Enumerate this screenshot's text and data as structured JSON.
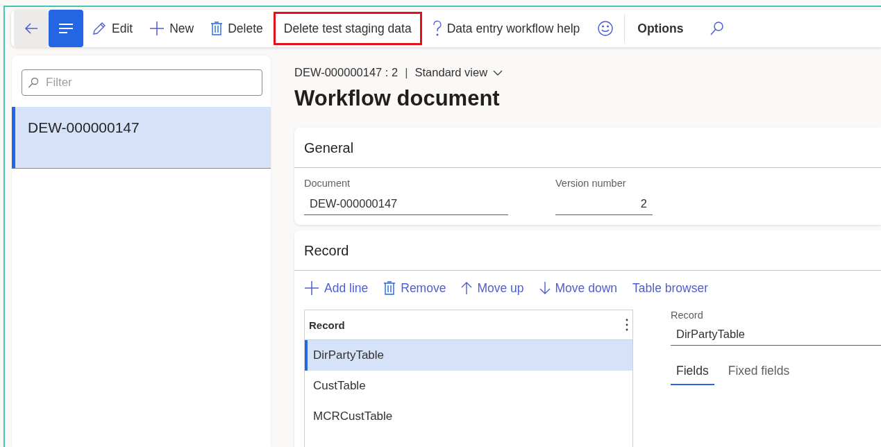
{
  "toolbar": {
    "items": [
      {
        "kind": "icon",
        "selected": false
      },
      {
        "kind": "icon",
        "selected": true
      },
      {
        "kind": "text",
        "label": "Edit",
        "highlighted": false
      },
      {
        "kind": "text",
        "label": "New",
        "highlighted": false
      },
      {
        "kind": "text",
        "label": "Delete",
        "highlighted": false
      },
      {
        "kind": "text",
        "label": "Delete test staging data",
        "highlighted": true
      },
      {
        "kind": "text",
        "label": "Data entry workflow help",
        "highlighted": false
      },
      {
        "kind": "icon",
        "selected": false
      },
      {
        "kind": "separator"
      },
      {
        "kind": "strong",
        "label": "Options"
      },
      {
        "kind": "icon",
        "selected": false
      }
    ]
  },
  "list_panel": {
    "filter": {
      "placeholder": "Filter"
    },
    "items": [
      {
        "label": "DEW-000000147",
        "selected": true
      }
    ]
  },
  "header": {
    "breadcrumb": "DEW-000000147 : 2",
    "separator": "|",
    "view": "Standard view",
    "title": "Workflow document"
  },
  "general": {
    "title": "General",
    "fields": [
      {
        "label": "Document",
        "value": "DEW-000000147"
      },
      {
        "label": "Version number",
        "value": "2"
      }
    ]
  },
  "record": {
    "title": "Record",
    "actions": [
      "Add line",
      "Remove",
      "Move up",
      "Move down",
      "Table browser"
    ],
    "grid": {
      "columns": [
        "Record"
      ],
      "rows": [
        {
          "cells": [
            "DirPartyTable"
          ],
          "selected": true
        },
        {
          "cells": [
            "CustTable"
          ],
          "selected": false
        },
        {
          "cells": [
            "MCRCustTable"
          ],
          "selected": false
        }
      ]
    },
    "detail": {
      "label": "Record",
      "value": "DirPartyTable"
    },
    "tabs": [
      {
        "label": "Fields",
        "selected": true
      },
      {
        "label": "Fixed fields",
        "selected": false
      }
    ]
  }
}
